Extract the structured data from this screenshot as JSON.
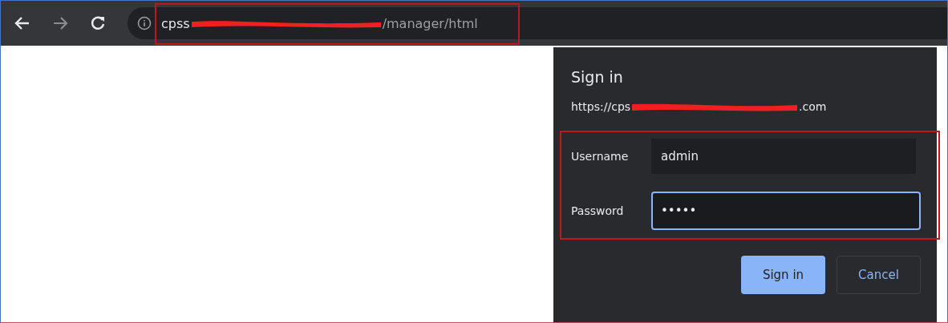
{
  "address_bar": {
    "host_start": "cpss",
    "path": "/manager/html"
  },
  "dialog": {
    "title": "Sign in",
    "origin_start": "https://cps",
    "origin_end": ".com",
    "fields": [
      {
        "label": "Username",
        "value": "admin",
        "focused": false
      },
      {
        "label": "Password",
        "value": "•••••",
        "focused": true
      }
    ],
    "buttons": [
      {
        "label": "Sign in",
        "kind": "primary"
      },
      {
        "label": "Cancel",
        "kind": "secondary"
      }
    ]
  }
}
